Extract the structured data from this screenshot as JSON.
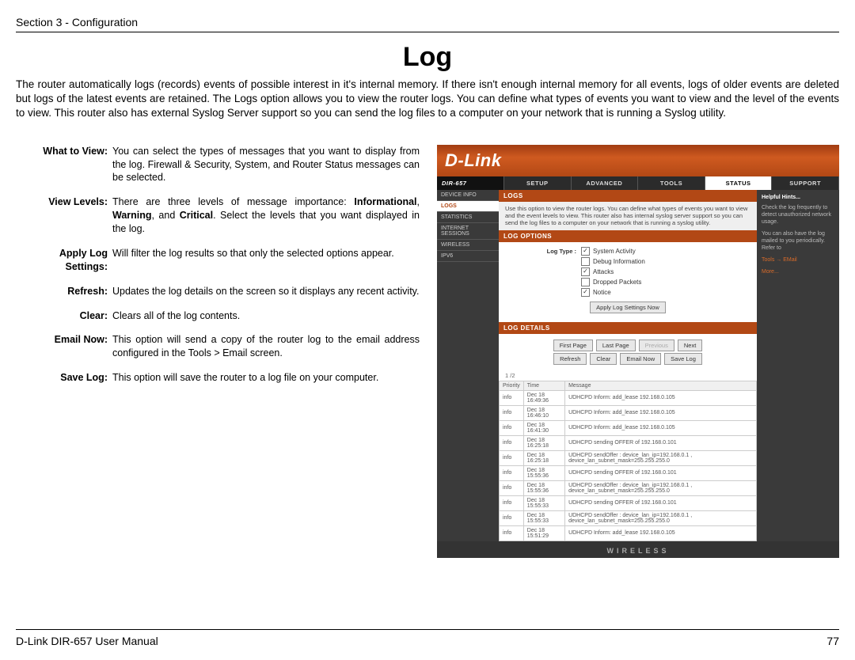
{
  "header": {
    "section": "Section 3 - Configuration"
  },
  "title": "Log",
  "intro": "The router automatically logs (records) events of possible interest in it's internal memory. If there isn't enough internal memory for all events, logs of older events are deleted but logs of the latest events are retained. The Logs option allows you to view the router logs. You can define what types of events you want to view and the level of the events to view. This router also has external Syslog Server support so you can send the log files to a computer on your network that is running a Syslog utility.",
  "defs": [
    {
      "label": "What to View:",
      "text": "You can select the types of messages that you want to display from the log. Firewall & Security, System, and Router Status messages can be selected."
    },
    {
      "label": "View Levels:",
      "html": "There are three levels of message importance: <b>Informational</b>, <b>Warning</b>, and <b>Critical</b>. Select the levels that you want displayed in the log."
    },
    {
      "label": "Apply Log Settings:",
      "text": "Will filter the log results so that only the selected options appear."
    },
    {
      "label": "Refresh:",
      "text": "Updates the log details on the screen so it displays any recent activity."
    },
    {
      "label": "Clear:",
      "text": "Clears all of the log contents."
    },
    {
      "label": "Email Now:",
      "text": "This option will send a copy of the router log to the email address configured in the Tools > Email screen."
    },
    {
      "label": "Save Log:",
      "text": "This option will save the router to a log file on your computer."
    }
  ],
  "router": {
    "brand": "D-Link",
    "model": "DIR-657",
    "tabs": [
      "SETUP",
      "ADVANCED",
      "TOOLS",
      "STATUS",
      "SUPPORT"
    ],
    "active_tab": "STATUS",
    "sidebar": [
      "DEVICE INFO",
      "LOGS",
      "STATISTICS",
      "INTERNET SESSIONS",
      "WIRELESS",
      "IPV6"
    ],
    "active_side": "LOGS",
    "section1": "LOGS",
    "desc": "Use this option to view the router logs. You can define what types of events you want to view and the event levels to view. This router also has internal syslog server support so you can send the log files to a computer on your network that is running a syslog utility.",
    "section2": "LOG OPTIONS",
    "log_type_label": "Log Type :",
    "options": [
      {
        "label": "System Activity",
        "checked": true
      },
      {
        "label": "Debug Information",
        "checked": false
      },
      {
        "label": "Attacks",
        "checked": true
      },
      {
        "label": "Dropped Packets",
        "checked": false
      },
      {
        "label": "Notice",
        "checked": true
      }
    ],
    "apply_btn": "Apply Log Settings Now",
    "section3": "LOG DETAILS",
    "btns_row1": [
      "First Page",
      "Last Page",
      "Previous",
      "Next"
    ],
    "btns_row2": [
      "Refresh",
      "Clear",
      "Email Now",
      "Save Log"
    ],
    "page_indicator": "1 /2",
    "cols": [
      "Priority",
      "Time",
      "Message"
    ],
    "rows": [
      [
        "info",
        "Dec 18 16:49:36",
        "UDHCPD Inform: add_lease 192.168.0.105"
      ],
      [
        "info",
        "Dec 18 16:46:10",
        "UDHCPD Inform: add_lease 192.168.0.105"
      ],
      [
        "info",
        "Dec 18 16:41:30",
        "UDHCPD Inform: add_lease 192.168.0.105"
      ],
      [
        "info",
        "Dec 18 16:25:18",
        "UDHCPD sending OFFER of 192.168.0.101"
      ],
      [
        "info",
        "Dec 18 16:25:18",
        "UDHCPD sendOffer : device_lan_ip=192.168.0.1 , device_lan_subnet_mask=255.255.255.0"
      ],
      [
        "info",
        "Dec 18 15:55:36",
        "UDHCPD sending OFFER of 192.168.0.101"
      ],
      [
        "info",
        "Dec 18 15:55:36",
        "UDHCPD sendOffer : device_lan_ip=192.168.0.1 , device_lan_subnet_mask=255.255.255.0"
      ],
      [
        "info",
        "Dec 18 15:55:33",
        "UDHCPD sending OFFER of 192.168.0.101"
      ],
      [
        "info",
        "Dec 18 15:55:33",
        "UDHCPD sendOffer : device_lan_ip=192.168.0.1 , device_lan_subnet_mask=255.255.255.0"
      ],
      [
        "info",
        "Dec 18 15:51:29",
        "UDHCPD Inform: add_lease 192.168.0.105"
      ]
    ],
    "help_head": "Helpful Hints...",
    "help1": "Check the log frequently to detect unauthorized network usage.",
    "help2": "You can also have the log mailed to you periodically. Refer to",
    "help_link": "Tools → EMail",
    "help_more": "More...",
    "footer": "WIRELESS"
  },
  "footer": {
    "manual": "D-Link DIR-657 User Manual",
    "page": "77"
  }
}
